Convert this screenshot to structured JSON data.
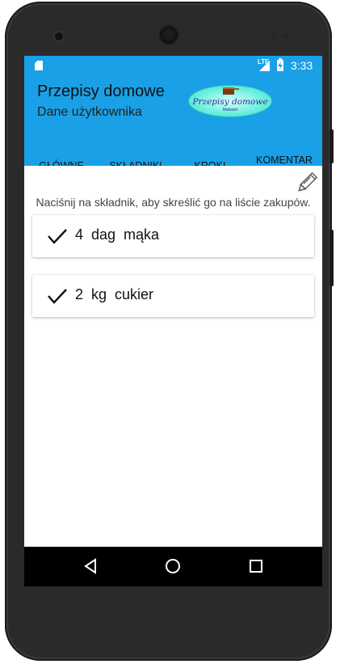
{
  "status_bar": {
    "network_label": "LTE",
    "time": "3:33",
    "icons": [
      "sd-card-icon",
      "signal-icon",
      "battery-charging-icon"
    ]
  },
  "app_bar": {
    "title": "Przepisy domowe",
    "subtitle": "Dane użytkownika",
    "logo": {
      "text": "Przepisy domowe",
      "subtext": "Makasin"
    }
  },
  "tabs": [
    {
      "label": "GŁÓWNE",
      "active": false
    },
    {
      "label": "SKŁADNIKI",
      "active": true
    },
    {
      "label": "KROKI",
      "active": false
    },
    {
      "label": "KOMENTAR Z",
      "active": false
    }
  ],
  "content": {
    "hint": "Naciśnij na składnik, aby skreślić go na liście zakupów.",
    "ingredients": [
      {
        "amount": "4",
        "unit": "dag",
        "name": "mąka",
        "text": "4  dag  mąka",
        "checked": true
      },
      {
        "amount": "2",
        "unit": "kg",
        "name": "cukier",
        "text": "2  kg  cukier",
        "checked": true
      }
    ]
  },
  "colors": {
    "primary": "#1aa0e6",
    "tab_indicator": "#8e2020",
    "nav_bar": "#000000"
  },
  "nav_bar": {
    "buttons": [
      "back-icon",
      "home-icon",
      "recents-icon"
    ]
  }
}
